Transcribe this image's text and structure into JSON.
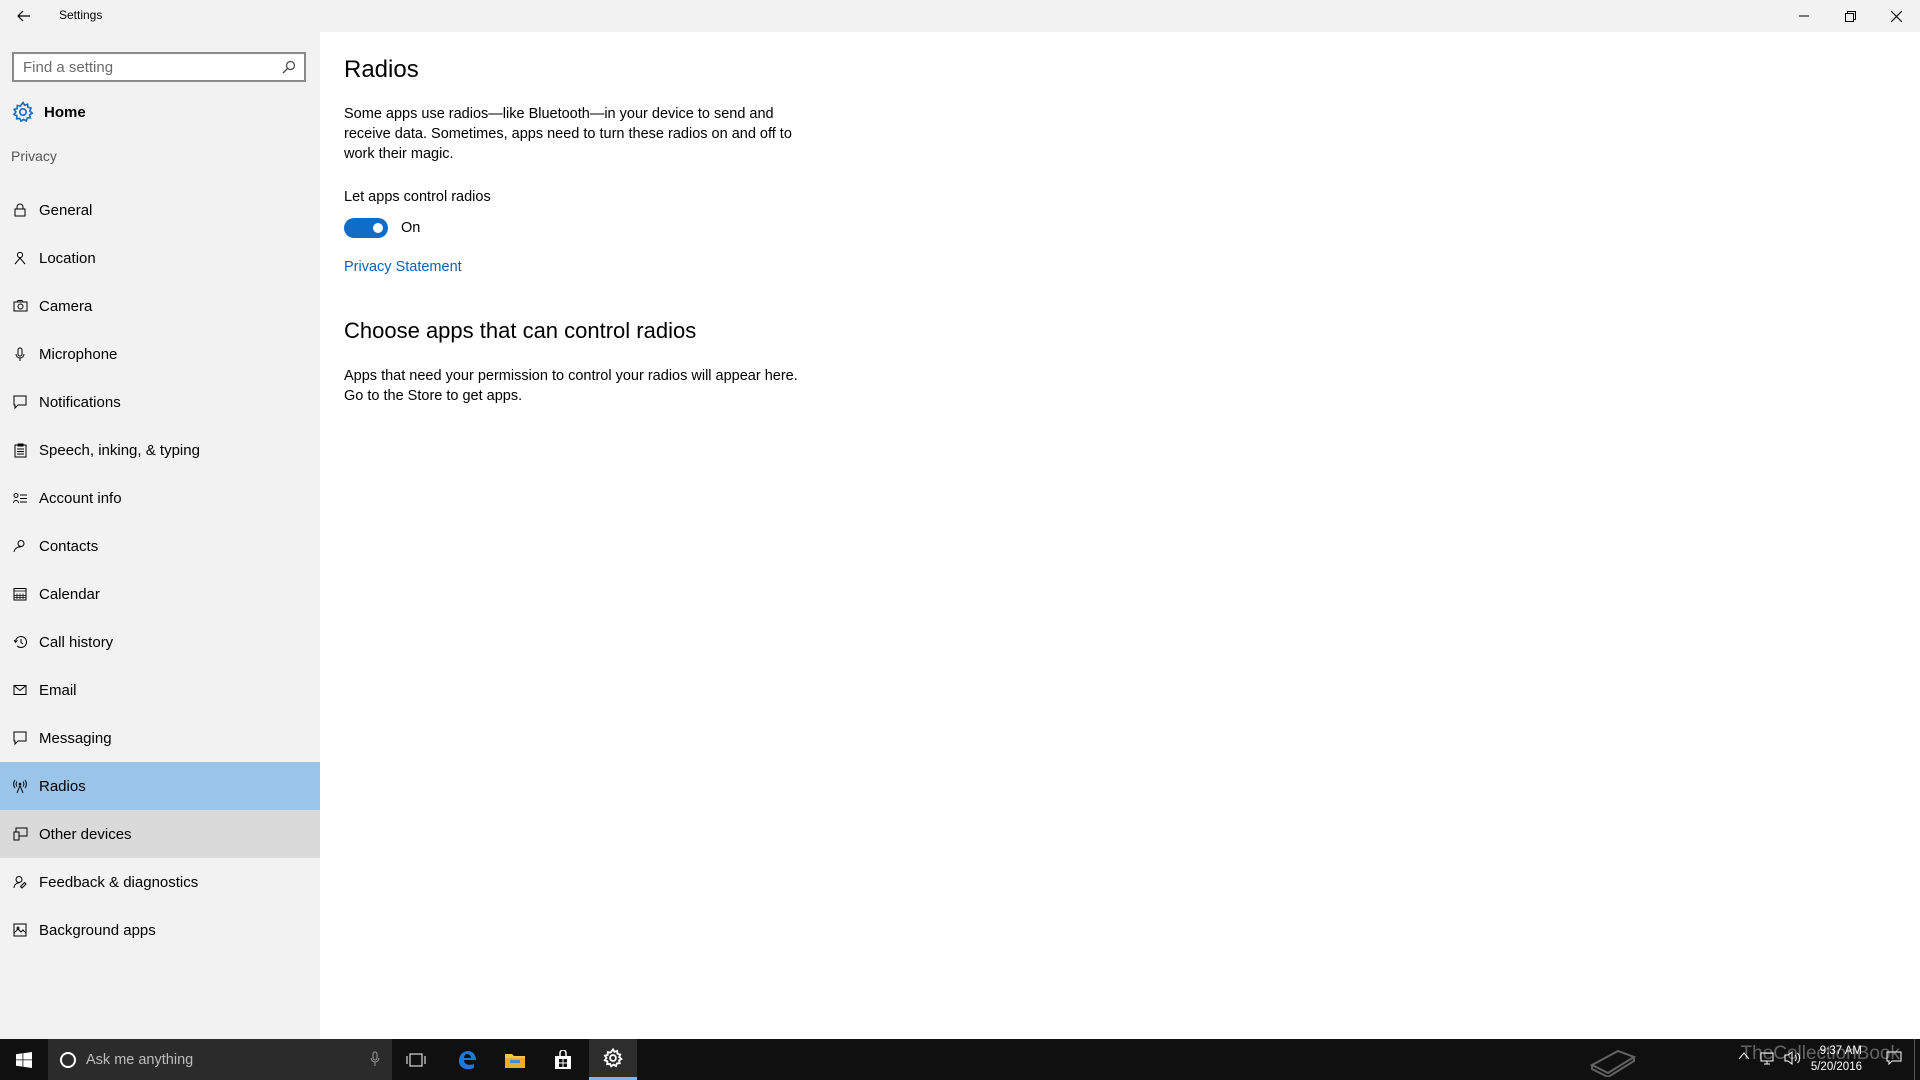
{
  "window": {
    "title": "Settings",
    "icons": [
      "back-arrow-icon",
      "minimize-icon",
      "restore-icon",
      "close-icon"
    ]
  },
  "sidebar": {
    "search_placeholder": "Find a setting",
    "home_label": "Home",
    "section_label": "Privacy",
    "items": [
      {
        "label": "General",
        "icon": "lock-icon"
      },
      {
        "label": "Location",
        "icon": "location-person-icon"
      },
      {
        "label": "Camera",
        "icon": "camera-icon"
      },
      {
        "label": "Microphone",
        "icon": "microphone-icon"
      },
      {
        "label": "Notifications",
        "icon": "notifications-icon"
      },
      {
        "label": "Speech, inking, & typing",
        "icon": "clipboard-icon"
      },
      {
        "label": "Account info",
        "icon": "account-info-icon"
      },
      {
        "label": "Contacts",
        "icon": "contacts-icon"
      },
      {
        "label": "Calendar",
        "icon": "calendar-icon"
      },
      {
        "label": "Call history",
        "icon": "history-icon"
      },
      {
        "label": "Email",
        "icon": "email-icon"
      },
      {
        "label": "Messaging",
        "icon": "messaging-icon"
      },
      {
        "label": "Radios",
        "icon": "radio-tower-icon",
        "selected": true
      },
      {
        "label": "Other devices",
        "icon": "devices-icon",
        "hover": true
      },
      {
        "label": "Feedback & diagnostics",
        "icon": "feedback-icon"
      },
      {
        "label": "Background apps",
        "icon": "background-apps-icon"
      }
    ]
  },
  "main": {
    "title": "Radios",
    "description": "Some apps use radios—like Bluetooth—in your device to send and receive data. Sometimes, apps need to turn these radios on and off to work their magic.",
    "toggle_label": "Let apps control radios",
    "toggle_state": "On",
    "privacy_link": "Privacy Statement",
    "section_title": "Choose apps that can control radios",
    "section_description": "Apps that need your permission to control your radios will appear here. Go to the Store to get apps."
  },
  "taskbar": {
    "search_placeholder": "Ask me anything",
    "time": "9:37 AM",
    "date": "5/20/2016",
    "watermark": "TheCollectionBook",
    "accent_color": "#76b9ed"
  },
  "colors": {
    "accent": "#0f6cc7",
    "link": "#0b62b5",
    "selected_bg": "#9ac4e8",
    "sidebar_bg": "#f2f2f2"
  }
}
